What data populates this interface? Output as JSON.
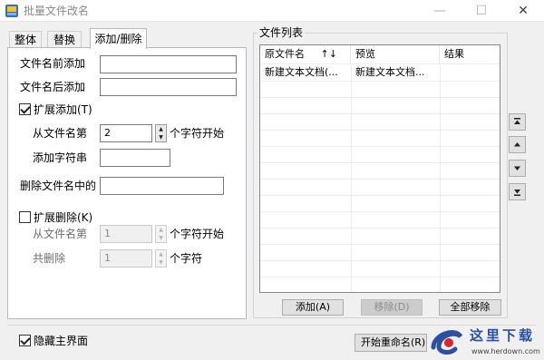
{
  "window": {
    "title": "批量文件改名",
    "min_glyph": "—",
    "max_glyph": "☐",
    "close_glyph": "✕"
  },
  "tabs": [
    {
      "label": "整体"
    },
    {
      "label": "替换"
    },
    {
      "label": "添加/删除",
      "active": true
    }
  ],
  "add_panel": {
    "prefix_label": "文件名前添加",
    "prefix_value": "",
    "suffix_label": "文件名后添加",
    "suffix_value": "",
    "extend_add_label": "扩展添加(T)",
    "extend_add_checked": true,
    "from_pos_label": "从文件名第",
    "from_pos_value": "2",
    "from_pos_unit": "个字符开始",
    "add_string_label": "添加字符串",
    "add_string_value": "",
    "delete_in_name_label": "删除文件名中的",
    "delete_in_name_value": "",
    "extend_delete_label": "扩展删除(K)",
    "extend_delete_checked": false,
    "del_from_label": "从文件名第",
    "del_from_value": "1",
    "del_from_unit": "个字符开始",
    "del_count_label": "共删除",
    "del_count_value": "1",
    "del_count_unit": "个字符"
  },
  "file_list": {
    "group_title": "文件列表",
    "columns": [
      "原文件名",
      "预览",
      "结果"
    ],
    "sort_indicator": "↑↓",
    "rows": [
      {
        "original": "新建文本文档(...",
        "preview": "新建文本文档...",
        "result": ""
      }
    ],
    "add_button": "添加(A)",
    "remove_button": "移除(D)",
    "remove_all_button": "全部移除"
  },
  "side_controls": {
    "top_icon": "move-top",
    "up_icon": "move-up",
    "down_icon": "move-down",
    "bottom_icon": "move-bottom"
  },
  "footer": {
    "hide_main_label": "隐藏主界面",
    "hide_main_checked": true,
    "start_button": "开始重命名(R)"
  },
  "watermark": {
    "text": "这里下载",
    "url": "www.herdown.com"
  },
  "colors": {
    "window_bg": "#f0f0f0",
    "watermark_blue": "#2c4fa0",
    "watermark_red": "#d8262c"
  }
}
